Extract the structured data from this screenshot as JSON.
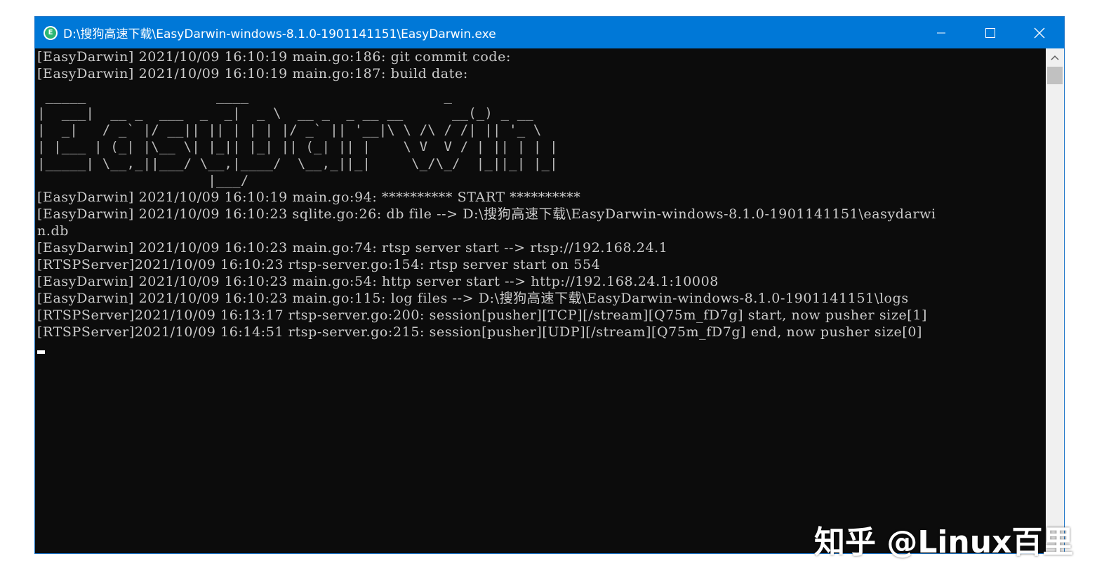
{
  "window": {
    "title": "D:\\搜狗高速下载\\EasyDarwin-windows-8.1.0-1901141151\\EasyDarwin.exe",
    "app_icon_letter": "E",
    "controls": [
      "minimize-icon",
      "maximize-icon",
      "close-icon"
    ],
    "titlebar_color": "#0078d7"
  },
  "console": {
    "header_lines": [
      "[EasyDarwin] 2021/10/09 16:10:19 main.go:186: git commit code:",
      "[EasyDarwin] 2021/10/09 16:10:19 main.go:187: build date:"
    ],
    "banner": " _____                ____                        _\n|  ___|  __ _  ___  _  _|  _ \\  __ _  _ __ __      __(_) _ __\n|  _|   / _` |/ __|| || | | | |/ _` || '__|\\ \\ /\\ / /| || '_ \\\n| |___ | (_| |\\__ \\| |_|| |_| || (_| || |    \\ V  V / | || | | |\n|_____| \\__,_||___/ \\__,|____/  \\__,_||_|     \\_/\\_/  |_||_| |_|\n                     |___/",
    "log_lines": [
      "[EasyDarwin] 2021/10/09 16:10:19 main.go:94: ********** START **********",
      "[EasyDarwin] 2021/10/09 16:10:23 sqlite.go:26: db file --> D:\\搜狗高速下载\\EasyDarwin-windows-8.1.0-1901141151\\easydarwi",
      "n.db",
      "[EasyDarwin] 2021/10/09 16:10:23 main.go:74: rtsp server start --> rtsp://192.168.24.1",
      "[RTSPServer]2021/10/09 16:10:23 rtsp-server.go:154: rtsp server start on 554",
      "[EasyDarwin] 2021/10/09 16:10:23 main.go:54: http server start --> http://192.168.24.1:10008",
      "[EasyDarwin] 2021/10/09 16:10:23 main.go:115: log files --> D:\\搜狗高速下载\\EasyDarwin-windows-8.1.0-1901141151\\logs",
      "[RTSPServer]2021/10/09 16:13:17 rtsp-server.go:200: session[pusher][TCP][/stream][Q75m_fD7g] start, now pusher size[1]",
      "[RTSPServer]2021/10/09 16:14:51 rtsp-server.go:215: session[pusher][UDP][/stream][Q75m_fD7g] end, now pusher size[0]"
    ],
    "background": "#0c0c0c",
    "text_color": "#cccccc"
  },
  "scrollbar": {
    "up_arrow_icon": "chevron-up-icon"
  },
  "watermark": "知乎 @Linux百里"
}
